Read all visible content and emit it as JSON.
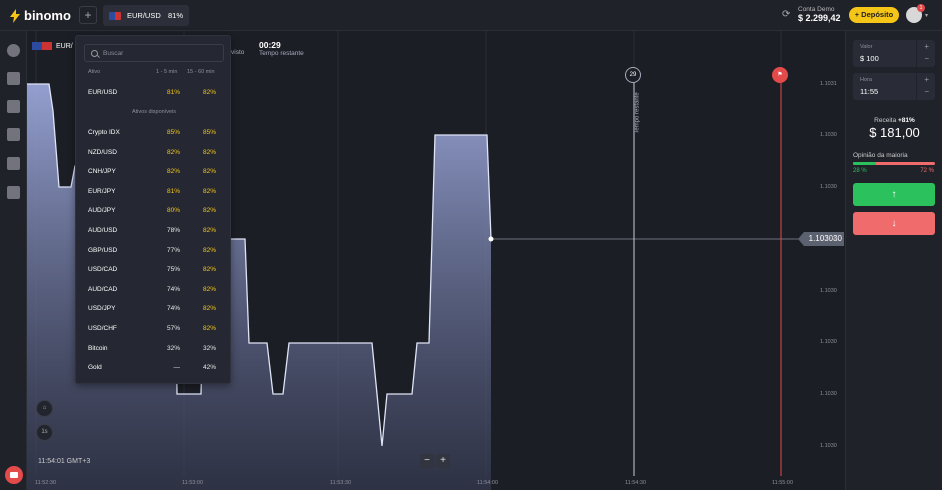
{
  "app": {
    "logo": "binomo"
  },
  "tabs": {
    "add": "+",
    "active": {
      "asset": "EUR/USD",
      "payout": "81%"
    }
  },
  "account": {
    "label": "Conta Demo",
    "balance": "$ 2.299,42",
    "deposit_label": "+ Depósito",
    "notification_count": "1"
  },
  "chart_header": {
    "asset": "EUR/",
    "timer": "00:29",
    "timer_label": "Tempo restante",
    "visto_label": "visto"
  },
  "chart_data": {
    "type": "area",
    "x_ticks": [
      "11:52:30",
      "11:53:00",
      "11:53:30",
      "11:54:00",
      "11:54:30",
      "11:55:00"
    ],
    "y_ticks": [
      "1.1031",
      "1.1030",
      "1.1030",
      "1.1030",
      "1.1030",
      "1.1030",
      "1.1030",
      "1.1030"
    ],
    "current_price": "1.103030",
    "markers": {
      "countdown": "29",
      "countdown_label": "Tempo restante"
    }
  },
  "chart_footer": {
    "clock": "11:54:01 GMT+3",
    "zoom_out": "−",
    "zoom_in": "+",
    "interval": "1s"
  },
  "dropdown": {
    "search_placeholder": "Buscar",
    "col_asset": "Ativo",
    "col_short": "1 - 5 min",
    "col_long": "15 - 60 min",
    "favorite": {
      "name": "EUR/USD",
      "p1": "81%",
      "p2": "82%"
    },
    "section_label": "Ativos disponíveis",
    "rows": [
      {
        "name": "Crypto IDX",
        "p1": "85%",
        "p2": "85%",
        "c1": "yel",
        "c2": "yel"
      },
      {
        "name": "NZD/USD",
        "p1": "82%",
        "p2": "82%",
        "c1": "yel",
        "c2": "yel"
      },
      {
        "name": "CNH/JPY",
        "p1": "82%",
        "p2": "82%",
        "c1": "yel",
        "c2": "yel"
      },
      {
        "name": "EUR/JPY",
        "p1": "81%",
        "p2": "82%",
        "c1": "yel",
        "c2": "yel"
      },
      {
        "name": "AUD/JPY",
        "p1": "80%",
        "p2": "82%",
        "c1": "yel",
        "c2": "yel"
      },
      {
        "name": "AUD/USD",
        "p1": "78%",
        "p2": "82%",
        "c1": "wht",
        "c2": "yel"
      },
      {
        "name": "GBP/USD",
        "p1": "77%",
        "p2": "82%",
        "c1": "wht",
        "c2": "yel"
      },
      {
        "name": "USD/CAD",
        "p1": "75%",
        "p2": "82%",
        "c1": "wht",
        "c2": "yel"
      },
      {
        "name": "AUD/CAD",
        "p1": "74%",
        "p2": "82%",
        "c1": "wht",
        "c2": "yel"
      },
      {
        "name": "USD/JPY",
        "p1": "74%",
        "p2": "82%",
        "c1": "wht",
        "c2": "yel"
      },
      {
        "name": "USD/CHF",
        "p1": "57%",
        "p2": "82%",
        "c1": "wht",
        "c2": "yel"
      },
      {
        "name": "Bitcoin",
        "p1": "32%",
        "p2": "32%",
        "c1": "wht",
        "c2": "wht"
      },
      {
        "name": "Gold",
        "p1": "—",
        "p2": "42%",
        "c1": "wht",
        "c2": "wht"
      }
    ]
  },
  "trade_panel": {
    "value_label": "Valor",
    "value": "$ 100",
    "time_label": "Hora",
    "time": "11:55",
    "receita_label": "Receita",
    "receita_pct": "+81%",
    "payout": "$ 181,00",
    "opinion_label": "Opinião da maioria",
    "opinion_up": "28 %",
    "opinion_down": "72 %",
    "opinion_up_fraction": 0.28,
    "up_label": "↑",
    "down_label": "↓"
  },
  "colors": {
    "accent_yellow": "#f5c518",
    "up_green": "#2bc25e",
    "down_red": "#f06b6b",
    "expiry_red": "#e34a4a"
  }
}
